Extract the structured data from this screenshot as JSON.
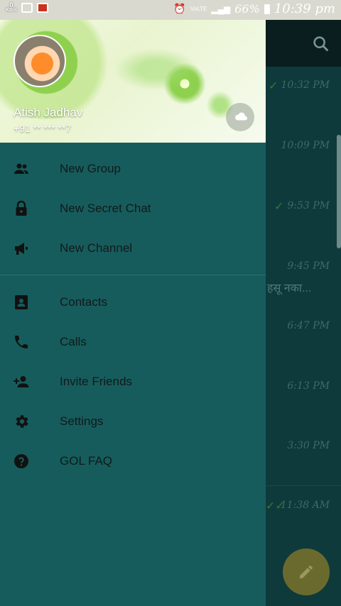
{
  "status_bar": {
    "net_speed": "0",
    "net_unit": "KB/s",
    "network": "VoLTE",
    "battery": "66%",
    "time": "10:39 pm"
  },
  "drawer": {
    "user_name": "Atish Jadhav",
    "user_phone": "+91 ** *** **7",
    "menu_group1": [
      {
        "label": "New Group",
        "icon": "group-icon"
      },
      {
        "label": "New Secret Chat",
        "icon": "lock-icon"
      },
      {
        "label": "New Channel",
        "icon": "megaphone-icon"
      }
    ],
    "menu_group2": [
      {
        "label": "Contacts",
        "icon": "contact-card-icon"
      },
      {
        "label": "Calls",
        "icon": "phone-icon"
      },
      {
        "label": "Invite Friends",
        "icon": "add-person-icon"
      },
      {
        "label": "Settings",
        "icon": "gear-icon"
      },
      {
        "label": "GOL FAQ",
        "icon": "question-icon"
      }
    ]
  },
  "chat_list": {
    "times": [
      "10:32 PM",
      "10:09 PM",
      "9:53 PM",
      "9:45 PM",
      "6:47 PM",
      "6:13 PM",
      "3:30 PM",
      "11:38 AM"
    ],
    "snippet": "हसू नका..."
  },
  "colors": {
    "drawer_bg": "#175c5c",
    "header_bg": "#f4fae4",
    "accent_green": "#8fd14f"
  }
}
